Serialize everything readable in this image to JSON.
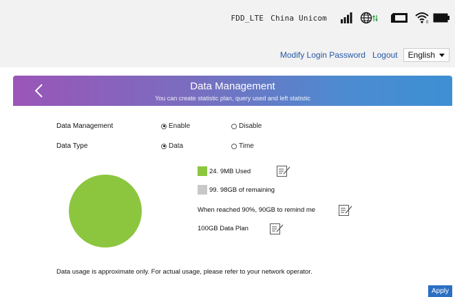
{
  "status": {
    "network_type": "FDD_LTE",
    "operator": "China Unicom"
  },
  "header": {
    "modify_password": "Modify Login Password",
    "logout": "Logout",
    "language": "English"
  },
  "banner": {
    "title": "Data Management",
    "subtitle": "You can create statistic plan, query used and left statistic"
  },
  "form": {
    "data_management_label": "Data Management",
    "enable_label": "Enable",
    "disable_label": "Disable",
    "data_type_label": "Data Type",
    "data_label": "Data",
    "time_label": "Time"
  },
  "usage": {
    "used_text": "24. 9MB Used",
    "remaining_text": "99. 98GB of remaining",
    "remind_text": "When reached 90%, 90GB  to remind me",
    "plan_text": "100GB Data Plan",
    "used_color": "#8cc63f",
    "remaining_color": "#c8c8c8"
  },
  "note": "Data usage is approximate only. For actual usage, please refer to your network operator.",
  "apply_label": "Apply"
}
